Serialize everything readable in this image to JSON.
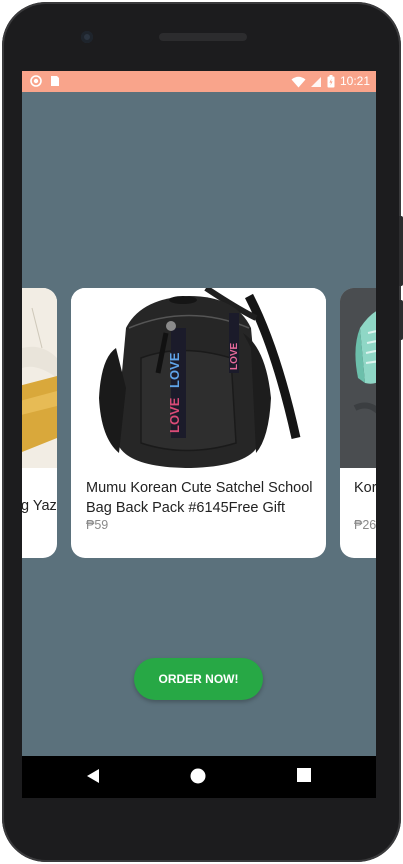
{
  "status_bar": {
    "time": "10:21",
    "color": "#f9a48b",
    "left_icons": [
      "record-icon",
      "sim-icon"
    ],
    "right_icons": [
      "wifi-icon",
      "signal-icon",
      "battery-icon"
    ]
  },
  "screen": {
    "background": "#5b717c"
  },
  "carousel": {
    "cards": [
      {
        "title": "g Yazi",
        "price": "",
        "image": "gift-box-photo"
      },
      {
        "title": "Mumu Korean Cute Satchel School Bag Back Pack #6145Free Gift",
        "price": "₱59",
        "image": "black-backpack-photo"
      },
      {
        "title": "Kor rub",
        "price": "₱26",
        "image": "mint-shoe-photo"
      }
    ]
  },
  "order_button": {
    "label": "ORDER NOW!",
    "color": "#27a845"
  },
  "nav_bar": {
    "buttons": [
      "back-icon",
      "home-icon",
      "recents-icon"
    ]
  }
}
